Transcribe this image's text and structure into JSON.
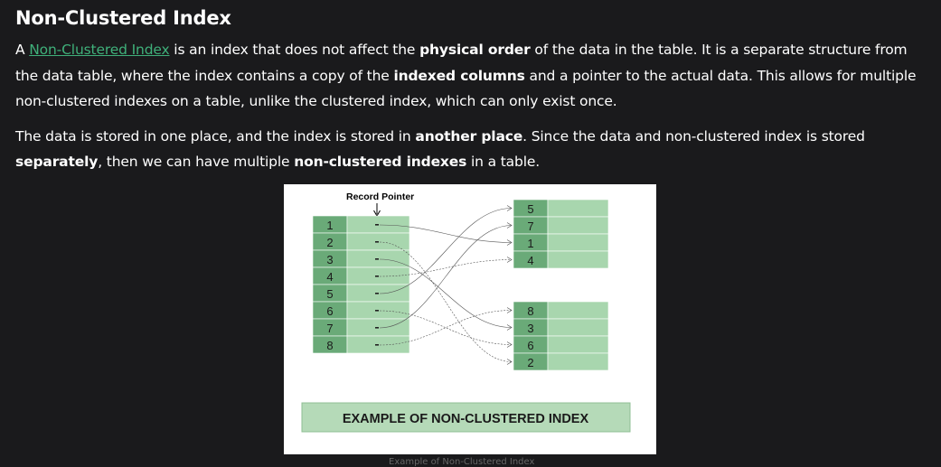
{
  "heading": "Non-Clustered Index",
  "para1": {
    "prefix": "A ",
    "link": "Non-Clustered Index",
    "t1": " is an index that does not affect the ",
    "b1": "physical order",
    "t2": " of the data in the table. It is a separate structure from the data table, where the index contains a copy of the ",
    "b2": "indexed columns",
    "t3": " and a pointer to the actual data. This allows for multiple non-clustered indexes on a table, unlike the clustered index, which can only exist once."
  },
  "para2": {
    "t1": "The data is stored in one place, and the index is stored in ",
    "b1": "another place",
    "t2": ". Since the data and non-clustered index is stored ",
    "b2": "separately",
    "t3": ", then we can have multiple ",
    "b3": "non-clustered indexes",
    "t4": " in a table."
  },
  "diagram": {
    "record_pointer_label": "Record Pointer",
    "index_keys": [
      "1",
      "2",
      "3",
      "4",
      "5",
      "6",
      "7",
      "8"
    ],
    "data_block_1": [
      "5",
      "7",
      "1",
      "4"
    ],
    "data_block_2": [
      "8",
      "3",
      "6",
      "2"
    ],
    "caption": "EXAMPLE OF NON-CLUSTERED INDEX",
    "colors": {
      "key_cell": "#6aaa78",
      "light_cell": "#a8d6ae",
      "caption_bg": "#b5dab8",
      "line": "#555555"
    }
  },
  "figure_caption": "Example of Non-Clustered Index"
}
